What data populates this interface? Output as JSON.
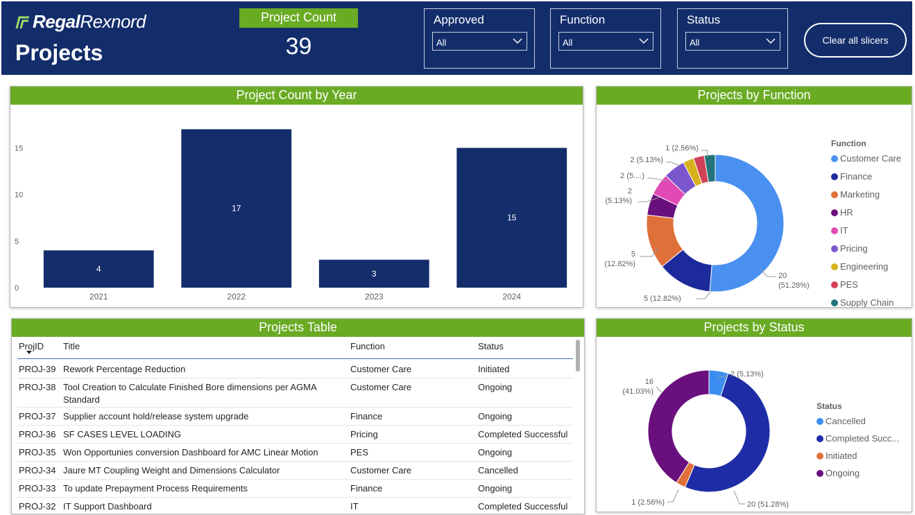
{
  "header": {
    "logo": {
      "brand_bold": "Regal",
      "brand_light": "Rexnord"
    },
    "page_title": "Projects",
    "project_count": {
      "label": "Project Count",
      "value": "39"
    },
    "slicers": [
      {
        "title": "Approved",
        "value": "All"
      },
      {
        "title": "Function",
        "value": "All"
      },
      {
        "title": "Status",
        "value": "All"
      }
    ],
    "clear_button": "Clear all slicers"
  },
  "theme": {
    "header_bg": "#132d6b",
    "accent_green": "#6aab24",
    "bar_color": "#142d6b"
  },
  "year_chart": {
    "title": "Project Count by Year",
    "chart_data": {
      "type": "bar",
      "categories": [
        "2021",
        "2022",
        "2023",
        "2024"
      ],
      "values": [
        4,
        17,
        3,
        15
      ],
      "yticks": [
        "0",
        "5",
        "10",
        "15"
      ],
      "ylim": [
        0,
        18
      ],
      "data_labels": [
        "4",
        "17",
        "3",
        "15"
      ]
    }
  },
  "function_chart": {
    "title": "Projects by Function",
    "legend_title": "Function",
    "chart_data": {
      "type": "pie",
      "labels": [
        "Customer Care",
        "Finance",
        "Marketing",
        "HR",
        "IT",
        "Pricing",
        "Engineering",
        "PES",
        "Supply Chain"
      ],
      "values": [
        20,
        5,
        5,
        2,
        2,
        2,
        1,
        1,
        1
      ],
      "colors": [
        "#4a90f0",
        "#1d2a9c",
        "#e0703a",
        "#6a0f7e",
        "#e14ab4",
        "#7c56cc",
        "#d8b21c",
        "#d24257",
        "#22747a"
      ],
      "data_labels": [
        "20\n(51.28%)",
        "5 (12.82%)",
        "5\n(12.82%)",
        "2\n(5.13%)",
        "2 (5....)",
        "2 (5.13%)",
        "1 (2.56%)"
      ]
    }
  },
  "table": {
    "title": "Projects Table",
    "columns": [
      "ProjID",
      "Title",
      "Function",
      "Status"
    ],
    "rows": [
      [
        "PROJ-39",
        "Rework Percentage Reduction",
        "Customer Care",
        "Initiated"
      ],
      [
        "PROJ-38",
        "Tool Creation to Calculate Finished Bore dimensions per AGMA Standard",
        "Customer Care",
        "Ongoing"
      ],
      [
        "PROJ-37",
        "Supplier account hold/release system upgrade",
        "Finance",
        "Ongoing"
      ],
      [
        "PROJ-36",
        "SF CASES LEVEL LOADING",
        "Pricing",
        "Completed Successful"
      ],
      [
        "PROJ-35",
        "Won Opportunies conversion Dashboard for AMC Linear Motion",
        "PES",
        "Ongoing"
      ],
      [
        "PROJ-34",
        "Jaure MT Coupling Weight and Dimensions Calculator",
        "Customer Care",
        "Cancelled"
      ],
      [
        "PROJ-33",
        "To update Prepayment Process Requirements",
        "Finance",
        "Ongoing"
      ],
      [
        "PROJ-32",
        "IT Support Dashboard",
        "IT",
        "Completed Successful"
      ]
    ]
  },
  "status_chart": {
    "title": "Projects by Status",
    "legend_title": "Status",
    "chart_data": {
      "type": "pie",
      "labels": [
        "Cancelled",
        "Completed Succ...",
        "Initiated",
        "Ongoing"
      ],
      "values": [
        2,
        20,
        1,
        16
      ],
      "colors": [
        "#3b8ef0",
        "#1e2da6",
        "#e0703a",
        "#6a0f7e"
      ],
      "data_labels": [
        "2 (5.13%)",
        "20 (51.28%)",
        "1 (2.56%)",
        "16\n(41.03%)"
      ]
    }
  }
}
